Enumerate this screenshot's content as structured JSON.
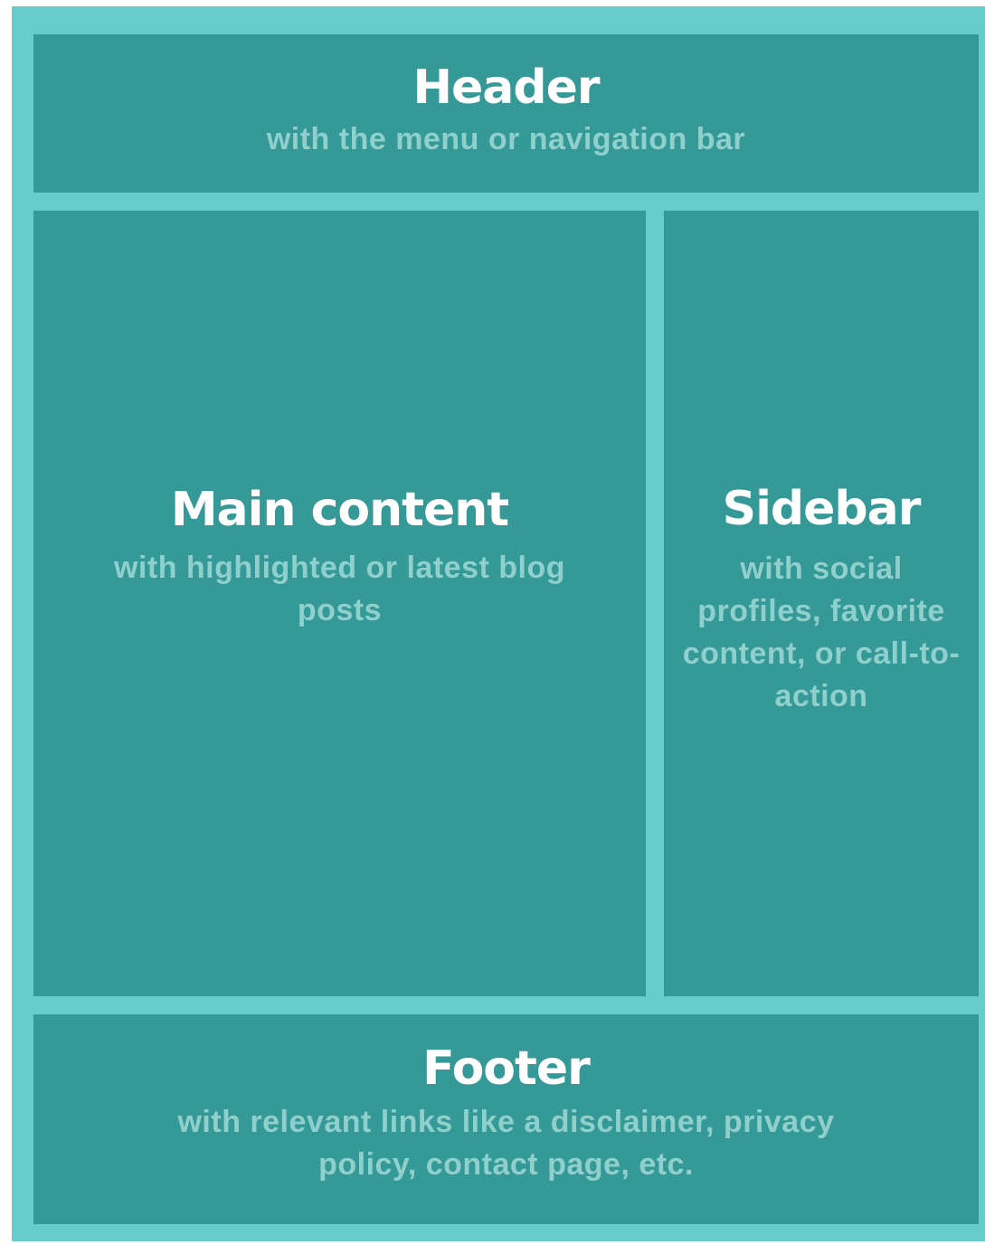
{
  "header": {
    "title": "Header",
    "description": "with the menu or navigation bar"
  },
  "main": {
    "title": "Main content",
    "description": "with highlighted or latest blog posts"
  },
  "sidebar": {
    "title": "Sidebar",
    "description": "with social profiles, favorite content, or call-to-action"
  },
  "footer": {
    "title": "Footer",
    "description": "with relevant links like a disclaimer, privacy policy, contact page, etc."
  },
  "colors": {
    "frame": "#67cdcb",
    "block": "#359997",
    "title": "#ffffff",
    "description": "#8fcfcc"
  }
}
